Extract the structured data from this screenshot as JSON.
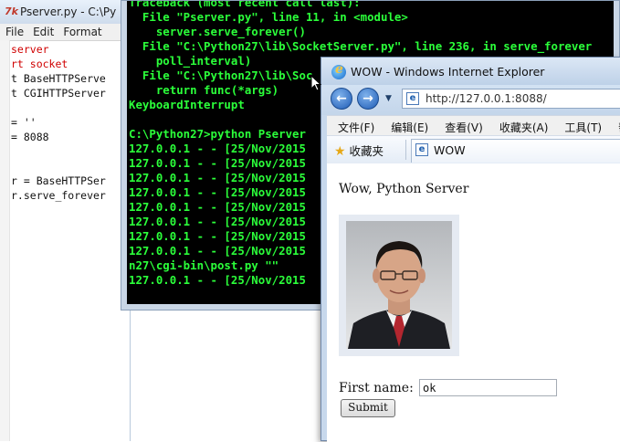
{
  "editor": {
    "logo": "7k",
    "title": "Pserver.py - C:\\Py",
    "menu": [
      "File",
      "Edit",
      "Format"
    ],
    "code": [
      {
        "text": "server",
        "color": "#d00000"
      },
      {
        "text": "rt socket",
        "color": "#d00000"
      },
      {
        "text": "t BaseHTTPServe",
        "color": "#111111"
      },
      {
        "text": "t CGIHTTPServer",
        "color": "#111111"
      },
      {
        "text": "",
        "color": "#111111"
      },
      {
        "text": "= ''",
        "color": "#111111"
      },
      {
        "text": "= 8088",
        "color": "#111111"
      },
      {
        "text": "",
        "color": "#111111"
      },
      {
        "text": "",
        "color": "#111111"
      },
      {
        "text": "r = BaseHTTPSer",
        "color": "#111111"
      },
      {
        "text": "r.serve_forever",
        "color": "#111111"
      }
    ]
  },
  "console": {
    "lines": [
      "Traceback (most recent call last):",
      "  File \"Pserver.py\", line 11, in <module>",
      "    server.serve_forever()",
      "  File \"C:\\Python27\\lib\\SocketServer.py\", line 236, in serve_forever",
      "    poll_interval)",
      "  File \"C:\\Python27\\lib\\Soc",
      "    return func(*args)",
      "KeyboardInterrupt",
      "",
      "C:\\Python27>python Pserver",
      "127.0.0.1 - - [25/Nov/2015",
      "127.0.0.1 - - [25/Nov/2015",
      "127.0.0.1 - - [25/Nov/2015",
      "127.0.0.1 - - [25/Nov/2015",
      "127.0.0.1 - - [25/Nov/2015",
      "127.0.0.1 - - [25/Nov/2015",
      "127.0.0.1 - - [25/Nov/2015",
      "127.0.0.1 - - [25/Nov/2015",
      "n27\\cgi-bin\\post.py \"\"",
      "127.0.0.1 - - [25/Nov/2015"
    ],
    "text_color": "#2bff3a"
  },
  "browser": {
    "title": "WOW - Windows Internet Explorer",
    "back_icon": "back-arrow-icon",
    "forward_icon": "forward-arrow-icon",
    "address": "http://127.0.0.1:8088/",
    "menu": [
      "文件(F)",
      "编辑(E)",
      "查看(V)",
      "收藏夹(A)",
      "工具(T)",
      "帮助"
    ],
    "favorites_label": "收藏夹",
    "tab_title": "WOW",
    "page": {
      "heading": "Wow, Python Server",
      "first_name_label": "First name:",
      "first_name_value": "ok",
      "submit_label": "Submit"
    }
  }
}
